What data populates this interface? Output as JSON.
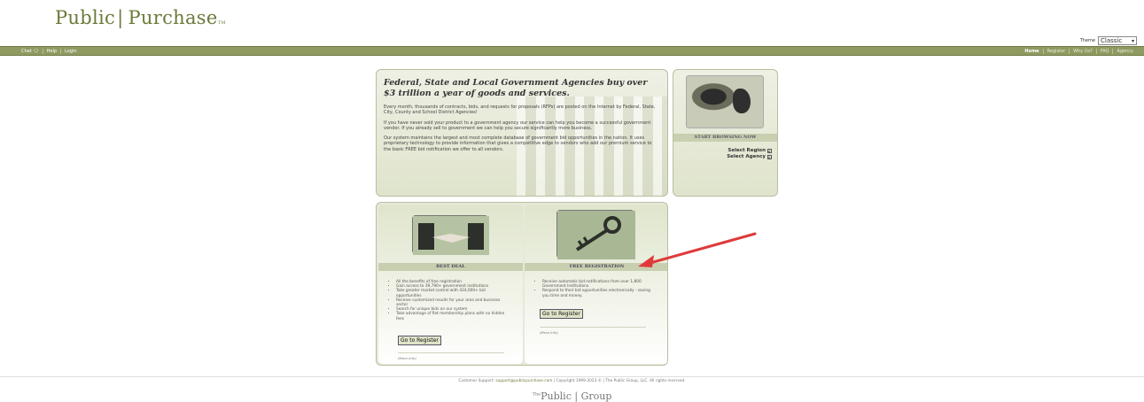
{
  "brand": {
    "word1": "Public",
    "word2": "Purchase",
    "tm": "TM"
  },
  "theme": {
    "label": "Theme",
    "selected": "Classic"
  },
  "nav": {
    "left": [
      "Chat 🗨",
      "Help",
      "Login"
    ],
    "right": [
      "Home",
      "Register",
      "Why Us?",
      "FAQ",
      "Agency"
    ]
  },
  "hero": {
    "title": "Federal, State and Local Government Agencies buy over $3 trillion a year of goods and services.",
    "p1": "Every month, thousands of contracts, bids, and requests for proposals (RFPs) are posted on the Internet by Federal, State, City, County and School District Agencies!",
    "p2": "If you have never sold your product to a government agency our service can help you become a successful government vendor. If you already sell to government we can help you secure significantly more business.",
    "p3": "Our system maintains the largest and most complete database of government bid opportunities in the nation. It uses proprietary technology to provide information that gives a competitive edge to vendors who add our premium service to the basic FREE bid notification we offer to all vendors."
  },
  "browse": {
    "header": "START BROWSING NOW",
    "region": "Select Region",
    "agency": "Select Agency"
  },
  "best_deal": {
    "header": "BEST DEAL",
    "items": [
      "All the benefits of free registration",
      "Gain access to 39,790+ government institutions",
      "Take greater market control with 424,600+ bid opportunities",
      "Receive customized results for your area and business sector",
      "Search for unique bids on our system",
      "Take advantage of flat membership plans with no hidden fees"
    ],
    "button": "Go to Register",
    "more": "(More Info)"
  },
  "free_reg": {
    "header": "FREE REGISTRATION",
    "items": [
      "Receive automatic bid notifications from over 1,800 Government Institutions.",
      "Respond to their bid opportunities electronically - saving you time and money."
    ],
    "button": "Go to Register",
    "more": "(More Info)"
  },
  "footer": {
    "prefix": "Customer Support:",
    "email": "support@publicpurchase.com",
    "suffix": "| Copyright 1999-2023 © | The Public Group, LLC. All rights reserved.",
    "logo_the": "The",
    "logo_public": "Public",
    "logo_group": "Group"
  },
  "colors": {
    "brand": "#6b7a3a",
    "nav": "#8f9a62",
    "arrow": "#e0393a"
  }
}
